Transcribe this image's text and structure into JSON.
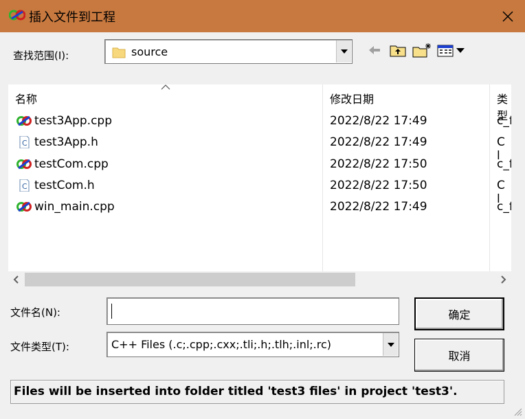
{
  "window": {
    "title": "插入文件到工程",
    "close_glyph": "✕",
    "icon": "visual-studio-icon",
    "titlebar_color": "#c8793f"
  },
  "look_in": {
    "label": "查找范围(I):",
    "value": "source",
    "arrow": "▾",
    "icon": "folder-icon"
  },
  "toolbar": {
    "back_icon": "back-arrow-icon",
    "up_icon": "up-one-level-icon",
    "new_folder_icon": "new-folder-icon",
    "view_menu_icon": "view-menu-icon"
  },
  "file_list": {
    "columns": [
      "名称",
      "修改日期",
      "类型"
    ],
    "sort_glyph": "^",
    "rows": [
      {
        "name": "test3App.cpp",
        "date": "2022/8/22 17:49",
        "type": "c_f",
        "icon": "cpp-file-icon"
      },
      {
        "name": "test3App.h",
        "date": "2022/8/22 17:49",
        "type": "C l",
        "icon": "header-file-icon"
      },
      {
        "name": "testCom.cpp",
        "date": "2022/8/22 17:50",
        "type": "c_f",
        "icon": "cpp-file-icon"
      },
      {
        "name": "testCom.h",
        "date": "2022/8/22 17:50",
        "type": "C l",
        "icon": "header-file-icon"
      },
      {
        "name": "win_main.cpp",
        "date": "2022/8/22 17:49",
        "type": "c_f",
        "icon": "cpp-file-icon"
      }
    ]
  },
  "scrollbar": {
    "left": "‹",
    "right": "›"
  },
  "file_name": {
    "label": "文件名(N):",
    "value": ""
  },
  "file_type": {
    "label": "文件类型(T):",
    "value": "C++ Files (.c;.cpp;.cxx;.tli;.h;.tlh;.inl;.rc)",
    "arrow": "▾"
  },
  "buttons": {
    "ok": "确定",
    "cancel": "取消"
  },
  "status_text": "Files will be inserted into folder titled 'test3 files' in project 'test3'."
}
